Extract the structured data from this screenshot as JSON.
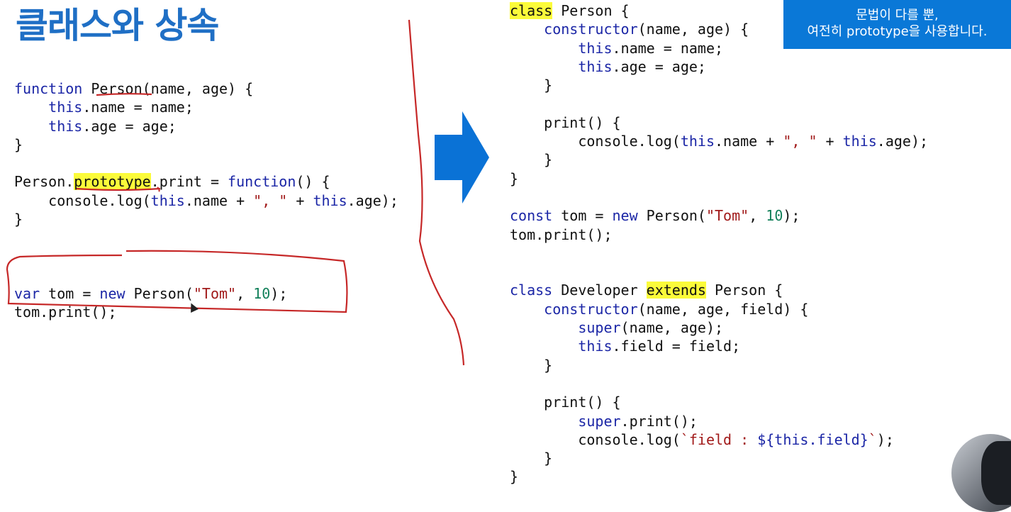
{
  "slide": {
    "title": "클래스와 상속",
    "note": {
      "line1": "문법이 다를 뿐,",
      "line2": "여전히 prototype을 사용합니다."
    }
  },
  "code_left": [
    [
      {
        "t": "function",
        "c": "kw"
      },
      {
        "t": " "
      },
      {
        "t": "Person"
      },
      {
        "t": "(name, age) {"
      }
    ],
    [
      {
        "t": "    "
      },
      {
        "t": "this",
        "c": "kw"
      },
      {
        "t": ".name = name;"
      }
    ],
    [
      {
        "t": "    "
      },
      {
        "t": "this",
        "c": "kw"
      },
      {
        "t": ".age = age;"
      }
    ],
    [
      {
        "t": "}"
      }
    ],
    [
      {
        "t": " "
      }
    ],
    [
      {
        "t": "Person."
      },
      {
        "t": "prototype",
        "c": "hl"
      },
      {
        "t": ".print = "
      },
      {
        "t": "function",
        "c": "kw"
      },
      {
        "t": "() {"
      }
    ],
    [
      {
        "t": "    console.log("
      },
      {
        "t": "this",
        "c": "kw"
      },
      {
        "t": ".name + "
      },
      {
        "t": "\", \"",
        "c": "str"
      },
      {
        "t": " + "
      },
      {
        "t": "this",
        "c": "kw"
      },
      {
        "t": ".age);"
      }
    ],
    [
      {
        "t": "}"
      }
    ],
    [
      {
        "t": " "
      }
    ],
    [
      {
        "t": " "
      }
    ],
    [
      {
        "t": "var",
        "c": "kw"
      },
      {
        "t": " tom = "
      },
      {
        "t": "new",
        "c": "kw"
      },
      {
        "t": " Person("
      },
      {
        "t": "\"Tom\"",
        "c": "str"
      },
      {
        "t": ", "
      },
      {
        "t": "10",
        "c": "num"
      },
      {
        "t": ");"
      }
    ],
    [
      {
        "t": "tom.print();"
      }
    ]
  ],
  "code_right": [
    [
      {
        "t": "class",
        "c": "hl"
      },
      {
        "t": " Person {"
      }
    ],
    [
      {
        "t": "    "
      },
      {
        "t": "constructor",
        "c": "kw"
      },
      {
        "t": "(name, age) {"
      }
    ],
    [
      {
        "t": "        "
      },
      {
        "t": "this",
        "c": "kw"
      },
      {
        "t": ".name = name;"
      }
    ],
    [
      {
        "t": "        "
      },
      {
        "t": "this",
        "c": "kw"
      },
      {
        "t": ".age = age;"
      }
    ],
    [
      {
        "t": "    }"
      }
    ],
    [
      {
        "t": " "
      }
    ],
    [
      {
        "t": "    print() {"
      }
    ],
    [
      {
        "t": "        console.log("
      },
      {
        "t": "this",
        "c": "kw"
      },
      {
        "t": ".name + "
      },
      {
        "t": "\", \"",
        "c": "str"
      },
      {
        "t": " + "
      },
      {
        "t": "this",
        "c": "kw"
      },
      {
        "t": ".age);"
      }
    ],
    [
      {
        "t": "    }"
      }
    ],
    [
      {
        "t": "}"
      }
    ],
    [
      {
        "t": " "
      }
    ],
    [
      {
        "t": "const",
        "c": "kw"
      },
      {
        "t": " tom = "
      },
      {
        "t": "new",
        "c": "kw"
      },
      {
        "t": " Person("
      },
      {
        "t": "\"Tom\"",
        "c": "str"
      },
      {
        "t": ", "
      },
      {
        "t": "10",
        "c": "num"
      },
      {
        "t": ");"
      }
    ],
    [
      {
        "t": "tom.print();"
      }
    ],
    [
      {
        "t": " "
      }
    ],
    [
      {
        "t": " "
      }
    ],
    [
      {
        "t": "class",
        "c": "kw"
      },
      {
        "t": " Developer "
      },
      {
        "t": "extends",
        "c": "hl"
      },
      {
        "t": " Person {"
      }
    ],
    [
      {
        "t": "    "
      },
      {
        "t": "constructor",
        "c": "kw"
      },
      {
        "t": "(name, age, field) {"
      }
    ],
    [
      {
        "t": "        "
      },
      {
        "t": "super",
        "c": "kw"
      },
      {
        "t": "(name, age);"
      }
    ],
    [
      {
        "t": "        "
      },
      {
        "t": "this",
        "c": "kw"
      },
      {
        "t": ".field = field;"
      }
    ],
    [
      {
        "t": "    }"
      }
    ],
    [
      {
        "t": " "
      }
    ],
    [
      {
        "t": "    print() {"
      }
    ],
    [
      {
        "t": "        "
      },
      {
        "t": "super",
        "c": "kw"
      },
      {
        "t": ".print();"
      }
    ],
    [
      {
        "t": "        console.log("
      },
      {
        "t": "`field : ",
        "c": "str"
      },
      {
        "t": "${this.field}",
        "c": "kw"
      },
      {
        "t": "`",
        "c": "str"
      },
      {
        "t": ");"
      }
    ],
    [
      {
        "t": "    }"
      }
    ],
    [
      {
        "t": "}"
      }
    ]
  ],
  "colors": {
    "title": "#1f6fc5",
    "note_bg": "#0a78d7",
    "arrow": "#0a72d6",
    "annotation": "#c62828",
    "highlight": "#fbfb3a",
    "keyword": "#1b26a6",
    "string": "#a11a1a",
    "number": "#12805a"
  },
  "icons": {
    "arrow": "arrow-right-icon",
    "cursor": "mouse-cursor-icon"
  }
}
